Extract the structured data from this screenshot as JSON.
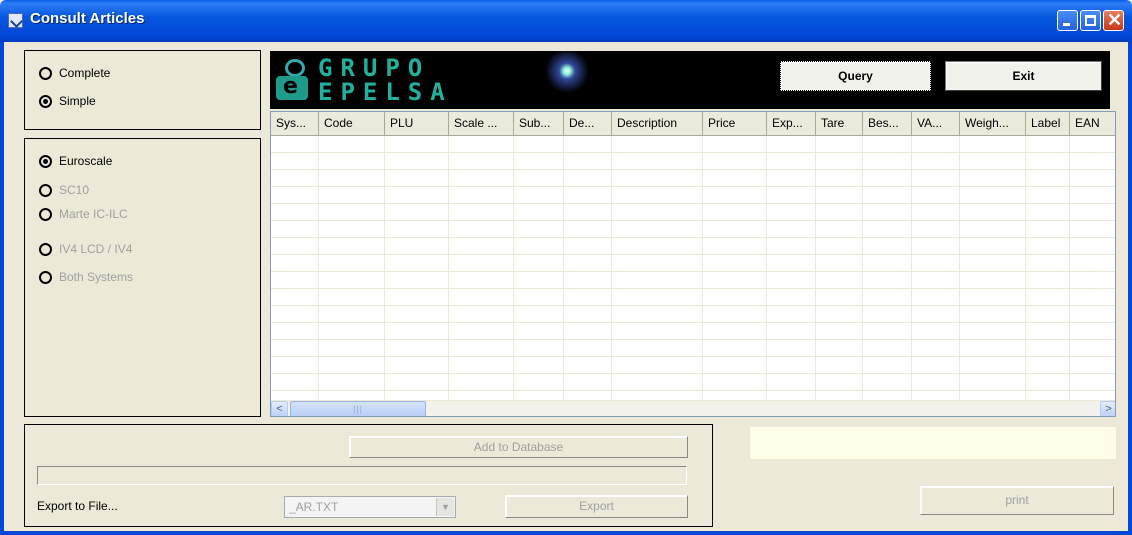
{
  "window": {
    "title": "Consult Articles",
    "icons": {
      "app": "app-icon",
      "minimize": "minimize-icon",
      "maximize": "maximize-icon",
      "close": "close-icon"
    },
    "close_glyph": "✕",
    "accent": "#0347d6"
  },
  "mode_group": {
    "options": [
      {
        "label": "Complete",
        "selected": false
      },
      {
        "label": "Simple",
        "selected": true
      }
    ]
  },
  "system_group": {
    "options": [
      {
        "label": "Euroscale",
        "selected": true,
        "enabled": true
      },
      {
        "label": "SC10",
        "selected": false,
        "enabled": false
      },
      {
        "label": "Marte IC-ILC",
        "selected": false,
        "enabled": false
      },
      {
        "label": "IV4 LCD / IV4",
        "selected": false,
        "enabled": false
      },
      {
        "label": "Both Systems",
        "selected": false,
        "enabled": false
      }
    ]
  },
  "logo": {
    "line1": "GRUPO",
    "line2": "EPELSA",
    "mark_letter": "e"
  },
  "toolbar": {
    "query_label": "Query",
    "exit_label": "Exit"
  },
  "grid": {
    "columns": [
      "Sys...",
      "Code",
      "PLU",
      "Scale ...",
      "Sub...",
      "De...",
      "Description",
      "Price",
      "Exp...",
      "Tare",
      "Bes...",
      "VA...",
      "Weigh...",
      "Label",
      "EAN"
    ],
    "rows": [],
    "scroll_left_glyph": "<",
    "scroll_right_glyph": ">",
    "thumb_grip": "|||"
  },
  "export": {
    "add_label": "Add to Database",
    "export_to_file_label": "Export to File...",
    "file_value": "_AR.TXT",
    "combo_arrow": "▼",
    "export_label": "Export",
    "print_label": "print"
  }
}
